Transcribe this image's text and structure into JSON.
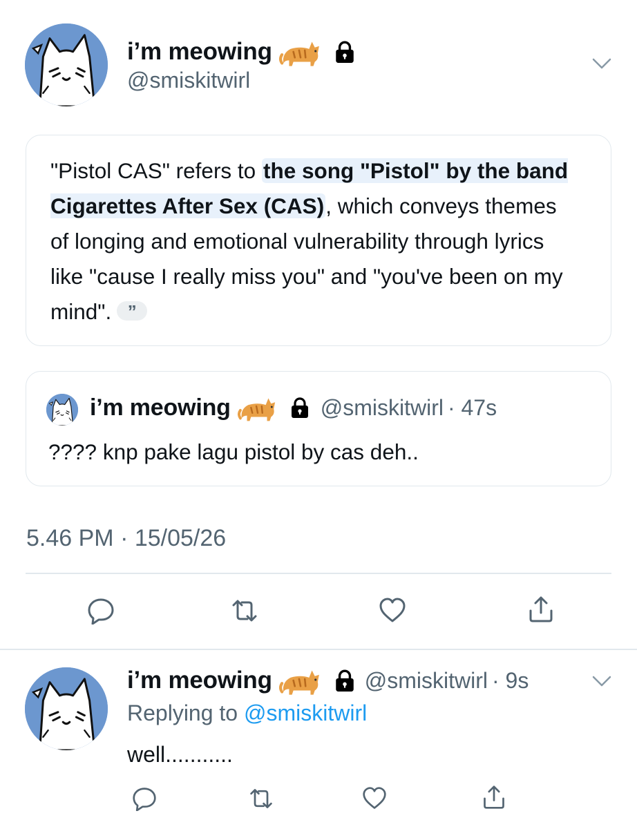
{
  "main_tweet": {
    "display_name": "i’m meowing",
    "handle": "@smiskitwirl",
    "icons": [
      "cat-emoji",
      "lock-icon",
      "chevron-down-icon"
    ]
  },
  "ai_answer": {
    "text_before": "\"Pistol CAS\" refers to ",
    "highlight": "the song \"Pistol\" by the band Cigarettes After Sex (CAS)",
    "text_after": ", which conveys themes of longing and emotional vulnerability through lyrics like \"cause I really miss you\" and \"you've been on my mind\".",
    "quote_mark": "”"
  },
  "quoted_tweet": {
    "display_name": "i’m meowing",
    "handle": "@smiskitwirl",
    "time": "· 47s",
    "text": "???? knp pake lagu pistol by cas deh.."
  },
  "timestamp": "5.46 PM · 15/05/26",
  "actions": [
    "reply-icon",
    "retweet-icon",
    "like-icon",
    "share-icon"
  ],
  "reply_tweet": {
    "display_name": "i’m meowing",
    "handle": "@smiskitwirl",
    "time": "· 9s",
    "replying_prefix": "Replying to ",
    "replying_handle": "@smiskitwirl",
    "text": "well..........."
  },
  "colors": {
    "link": "#1d9bf0",
    "muted": "#536471",
    "avatar_bg": "#6c97cf",
    "highlight_bg": "#e8f1fb"
  }
}
